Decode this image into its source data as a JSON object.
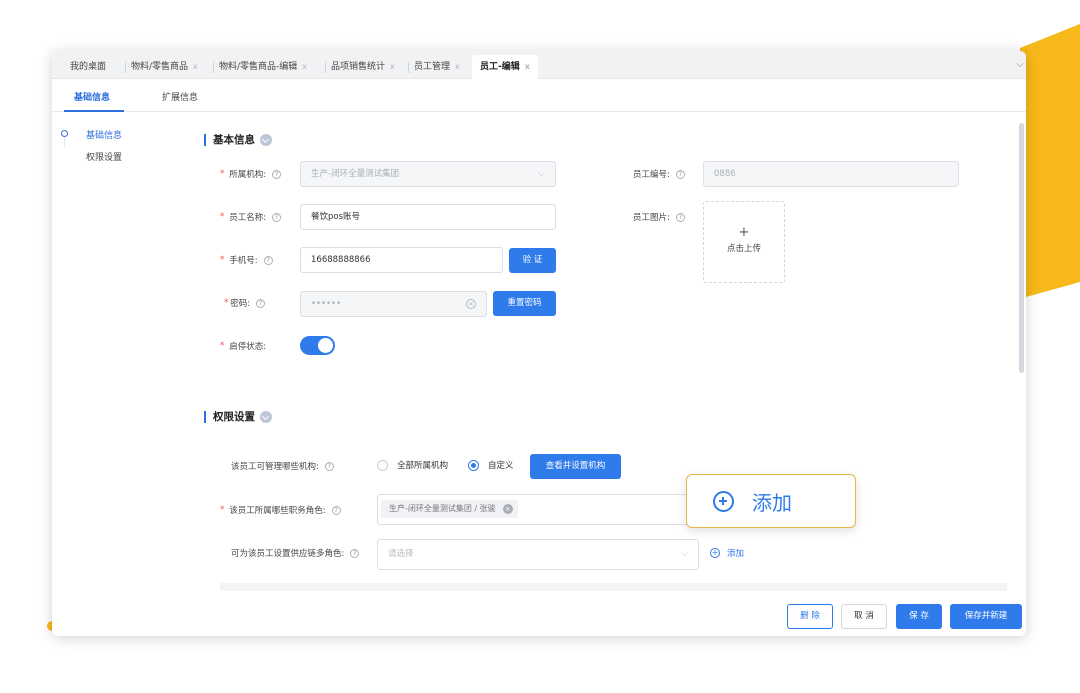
{
  "tabs": [
    {
      "label": "我的桌面",
      "closable": false
    },
    {
      "label": "物料/零售商品",
      "closable": true
    },
    {
      "label": "物料/零售商品-编辑",
      "closable": true
    },
    {
      "label": "品项销售统计",
      "closable": true
    },
    {
      "label": "员工管理",
      "closable": true
    },
    {
      "label": "员工-编辑",
      "closable": true,
      "active": true
    }
  ],
  "tab_close": "x",
  "subtabs": [
    "基础信息",
    "扩展信息"
  ],
  "side_nav": [
    "基础信息",
    "权限设置"
  ],
  "basic": {
    "title": "基本信息",
    "org_label": "所属机构:",
    "org_value": "生产-闭环全量测试集团",
    "emp_no_label": "员工编号:",
    "emp_no_value": "0886",
    "name_label": "员工名称:",
    "name_value": "餐饮pos账号",
    "photo_label": "员工图片:",
    "upload_plus": "+",
    "upload_text": "点击上传",
    "phone_label": "手机号:",
    "phone_value": "16688888866",
    "verify_btn": "验 证",
    "pwd_label": "密码:",
    "pwd_value": "••••••",
    "reset_pwd_btn": "重置密码",
    "status_label": "启停状态:",
    "status_on": true
  },
  "perm": {
    "title": "权限设置",
    "manage_label": "该员工可管理哪些机构:",
    "radio_all": "全部所属机构",
    "radio_custom": "自定义",
    "view_set_btn": "查看并设置机构",
    "role_label": "该员工所属哪些职务角色:",
    "role_tag": "生产-闭环全量测试集团 / 张骏",
    "supply_label": "可为该员工设置供应链多角色:",
    "supply_placeholder": "请选择",
    "add_link": "添加"
  },
  "footer": {
    "delete": "删 除",
    "cancel": "取 消",
    "save": "保 存",
    "save_new": "保存并新建"
  },
  "callout": {
    "label": "添加"
  },
  "colors": {
    "accent": "#2f7bec",
    "deco_yellow": "#f7b919",
    "required": "#f04b4b"
  }
}
